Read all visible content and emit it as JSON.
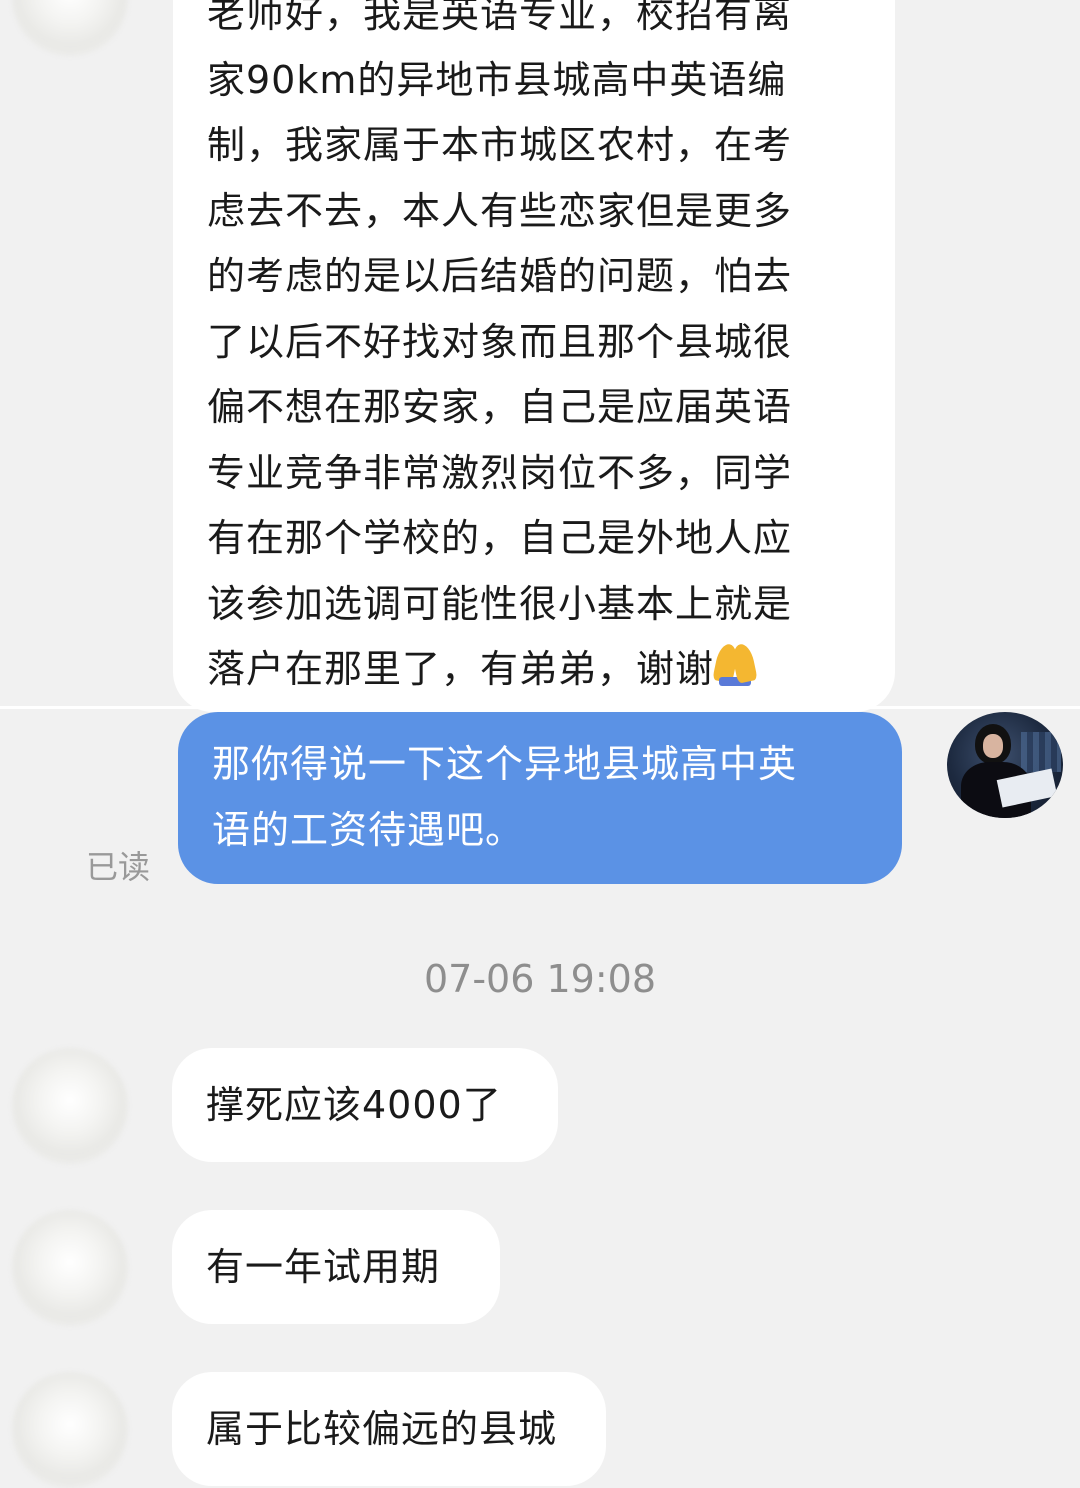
{
  "messages": {
    "first_incoming": {
      "text": "老师好，我是英语专业，校招有离\n家90km的异地市县城高中英语编\n制，我家属于本市城区农村，在考\n虑去不去，本人有些恋家但是更多\n的考虑的是以后结婚的问题，怕去\n了以后不好找对象而且那个县城很\n偏不想在那安家，自己是应届英语\n专业竞争非常激烈岗位不多，同学\n有在那个学校的，自己是外地人应\n该参加选调可能性很小基本上就是\n落户在那里了，有弟弟，谢谢",
      "emoji": "pray-emoji"
    },
    "outgoing": {
      "text": "那你得说一下这个异地县城高中英\n语的工资待遇吧。",
      "read_status": "已读"
    },
    "timestamp": "07-06 19:08",
    "replies": [
      {
        "text": "撑死应该4000了"
      },
      {
        "text": "有一年试用期"
      },
      {
        "text": "属于比较偏远的县城"
      }
    ]
  },
  "colors": {
    "background": "#f1f1f1",
    "incoming_bubble": "#ffffff",
    "outgoing_bubble": "#5b92e5"
  }
}
